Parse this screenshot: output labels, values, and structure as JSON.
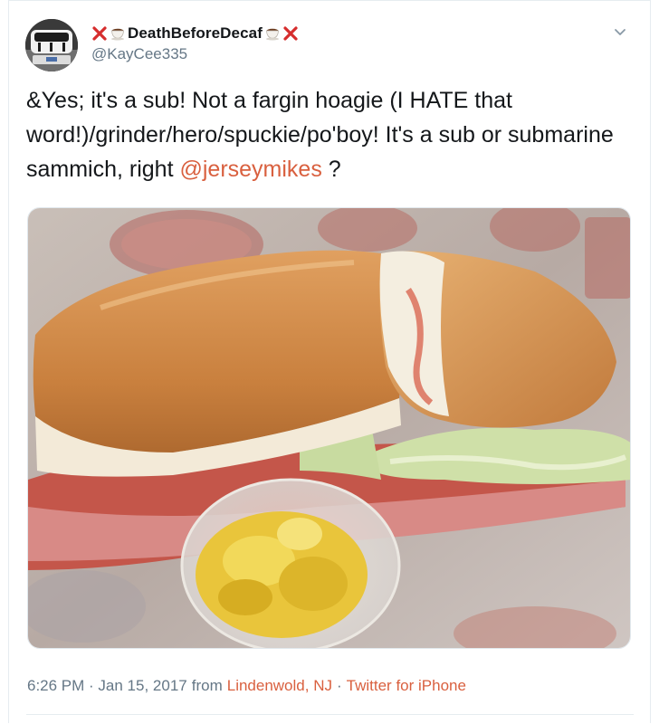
{
  "author": {
    "display_name": "DeathBeforeDecaf",
    "handle": "@KayCee335"
  },
  "tweet": {
    "text_main": "&Yes; it's a sub! Not a fargin hoagie (I HATE that word!)/grinder/hero/spuckie/po'boy! It's a sub or submarine sammich, right ",
    "mention": "@jerseymikes",
    "text_end": " ?"
  },
  "meta": {
    "time_date": "6:26 PM · Jan 15, 2017",
    "from_label": "from",
    "location": "Lindenwold, NJ",
    "separator": "·",
    "client": "Twitter for iPhone"
  },
  "colors": {
    "link": "#d9603f",
    "secondary_text": "#657786",
    "primary_text": "#14171a",
    "border": "#e6ecf0"
  },
  "icons": {
    "name_left": [
      "cross-mark-icon",
      "coffee-cup-icon"
    ],
    "name_right": [
      "coffee-cup-icon",
      "cross-mark-icon"
    ],
    "menu": "chevron-down-icon"
  }
}
